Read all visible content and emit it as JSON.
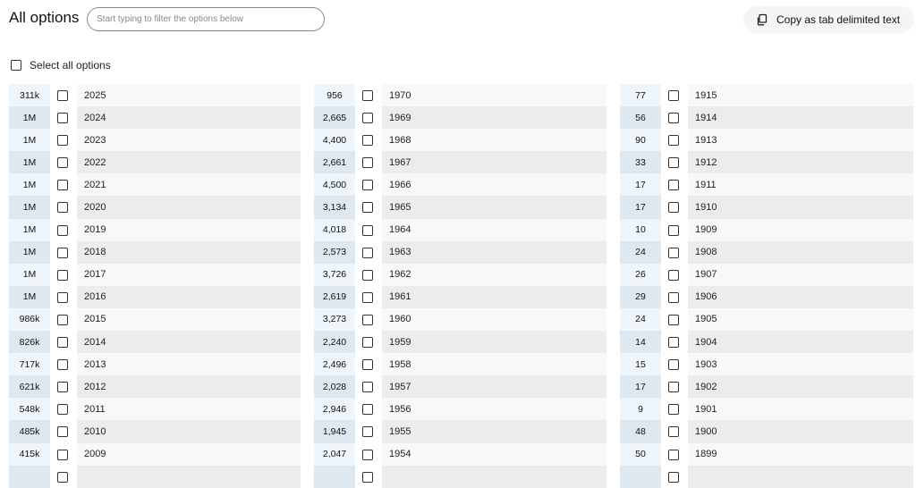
{
  "header": {
    "title": "All options",
    "search_placeholder": "Start typing to filter the options below",
    "copy_label": "Copy as tab delimited text"
  },
  "select_all_label": "Select all options",
  "columns": [
    {
      "rows": [
        {
          "count": "311k",
          "label": "2025"
        },
        {
          "count": "1M",
          "label": "2024"
        },
        {
          "count": "1M",
          "label": "2023"
        },
        {
          "count": "1M",
          "label": "2022"
        },
        {
          "count": "1M",
          "label": "2021"
        },
        {
          "count": "1M",
          "label": "2020"
        },
        {
          "count": "1M",
          "label": "2019"
        },
        {
          "count": "1M",
          "label": "2018"
        },
        {
          "count": "1M",
          "label": "2017"
        },
        {
          "count": "1M",
          "label": "2016"
        },
        {
          "count": "986k",
          "label": "2015"
        },
        {
          "count": "826k",
          "label": "2014"
        },
        {
          "count": "717k",
          "label": "2013"
        },
        {
          "count": "621k",
          "label": "2012"
        },
        {
          "count": "548k",
          "label": "2011"
        },
        {
          "count": "485k",
          "label": "2010"
        },
        {
          "count": "415k",
          "label": "2009"
        },
        {
          "count": "",
          "label": ""
        }
      ]
    },
    {
      "rows": [
        {
          "count": "956",
          "label": "1970"
        },
        {
          "count": "2,665",
          "label": "1969"
        },
        {
          "count": "4,400",
          "label": "1968"
        },
        {
          "count": "2,661",
          "label": "1967"
        },
        {
          "count": "4,500",
          "label": "1966"
        },
        {
          "count": "3,134",
          "label": "1965"
        },
        {
          "count": "4,018",
          "label": "1964"
        },
        {
          "count": "2,573",
          "label": "1963"
        },
        {
          "count": "3,726",
          "label": "1962"
        },
        {
          "count": "2,619",
          "label": "1961"
        },
        {
          "count": "3,273",
          "label": "1960"
        },
        {
          "count": "2,240",
          "label": "1959"
        },
        {
          "count": "2,496",
          "label": "1958"
        },
        {
          "count": "2,028",
          "label": "1957"
        },
        {
          "count": "2,946",
          "label": "1956"
        },
        {
          "count": "1,945",
          "label": "1955"
        },
        {
          "count": "2,047",
          "label": "1954"
        },
        {
          "count": "",
          "label": ""
        }
      ]
    },
    {
      "rows": [
        {
          "count": "77",
          "label": "1915"
        },
        {
          "count": "56",
          "label": "1914"
        },
        {
          "count": "90",
          "label": "1913"
        },
        {
          "count": "33",
          "label": "1912"
        },
        {
          "count": "17",
          "label": "1911"
        },
        {
          "count": "17",
          "label": "1910"
        },
        {
          "count": "10",
          "label": "1909"
        },
        {
          "count": "24",
          "label": "1908"
        },
        {
          "count": "26",
          "label": "1907"
        },
        {
          "count": "29",
          "label": "1906"
        },
        {
          "count": "24",
          "label": "1905"
        },
        {
          "count": "14",
          "label": "1904"
        },
        {
          "count": "15",
          "label": "1903"
        },
        {
          "count": "17",
          "label": "1902"
        },
        {
          "count": "9",
          "label": "1901"
        },
        {
          "count": "48",
          "label": "1900"
        },
        {
          "count": "50",
          "label": "1899"
        },
        {
          "count": "",
          "label": ""
        }
      ]
    }
  ]
}
